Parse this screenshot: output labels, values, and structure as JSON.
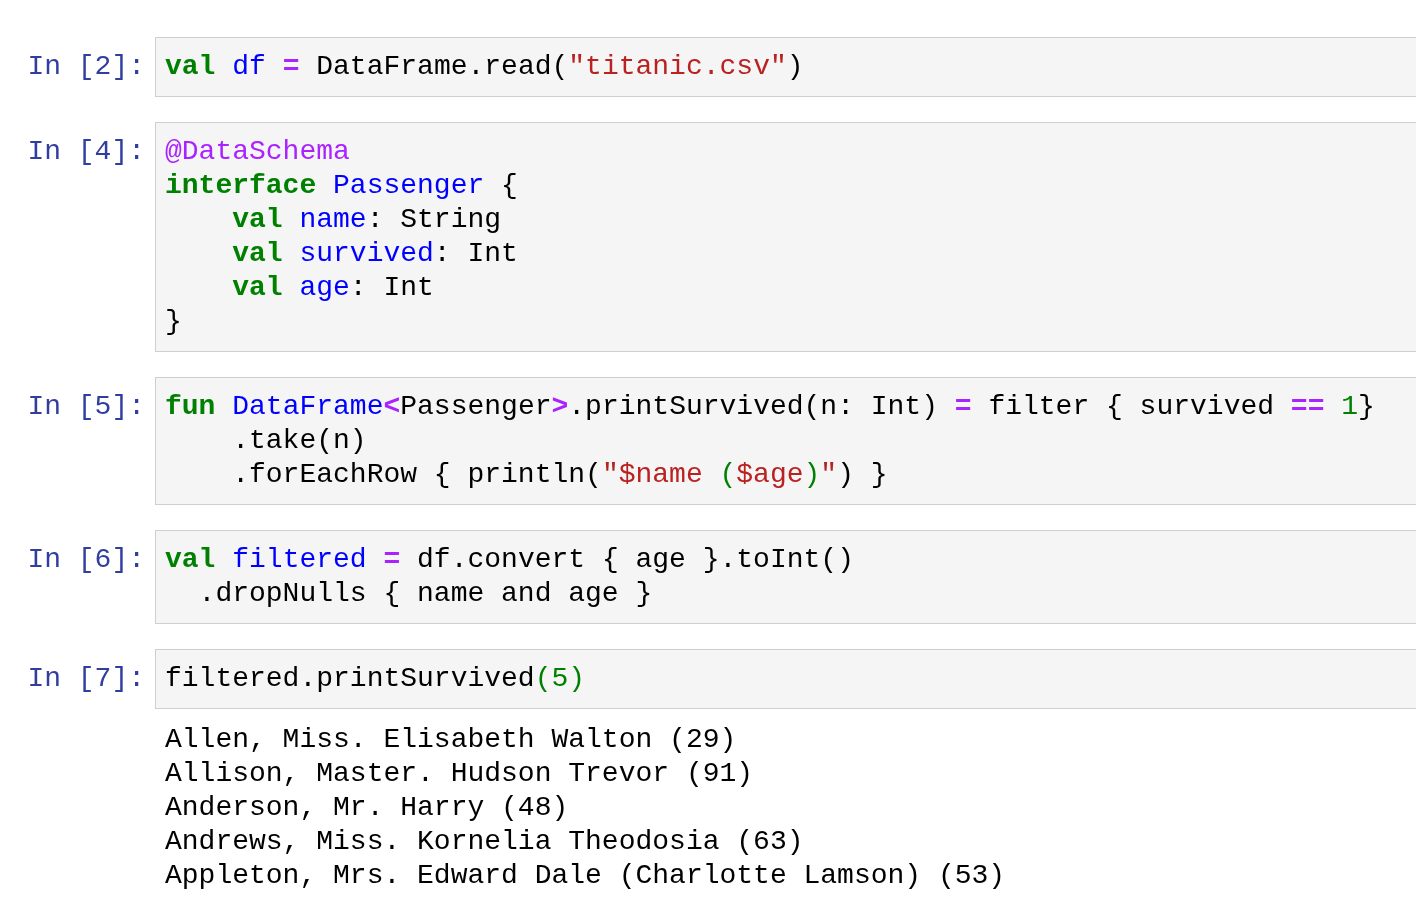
{
  "cells": [
    {
      "prompt": "In [2]:",
      "lines": [
        [
          {
            "kind": "keyword",
            "text": "val"
          },
          {
            "kind": "name",
            "text": " df"
          },
          {
            "kind": "operator",
            "text": " ="
          },
          {
            "kind": "plain",
            "text": " DataFrame.read("
          },
          {
            "kind": "string",
            "text": "\"titanic.csv\""
          },
          {
            "kind": "plain",
            "text": ")"
          }
        ]
      ]
    },
    {
      "prompt": "In [4]:",
      "lines": [
        [
          {
            "kind": "decorator",
            "text": "@DataSchema"
          }
        ],
        [
          {
            "kind": "keyword",
            "text": "interface"
          },
          {
            "kind": "name",
            "text": " Passenger"
          },
          {
            "kind": "plain",
            "text": " {"
          }
        ],
        [
          {
            "kind": "keyword",
            "text": "    val"
          },
          {
            "kind": "name",
            "text": " name"
          },
          {
            "kind": "plain",
            "text": ": String"
          }
        ],
        [
          {
            "kind": "keyword",
            "text": "    val"
          },
          {
            "kind": "name",
            "text": " survived"
          },
          {
            "kind": "plain",
            "text": ": Int"
          }
        ],
        [
          {
            "kind": "keyword",
            "text": "    val"
          },
          {
            "kind": "name",
            "text": " age"
          },
          {
            "kind": "plain",
            "text": ": Int"
          }
        ],
        [
          {
            "kind": "plain",
            "text": "}"
          }
        ]
      ]
    },
    {
      "prompt": "In [5]:",
      "lines": [
        [
          {
            "kind": "keyword",
            "text": "fun"
          },
          {
            "kind": "name",
            "text": " DataFrame"
          },
          {
            "kind": "operator",
            "text": "<"
          },
          {
            "kind": "plain",
            "text": "Passenger"
          },
          {
            "kind": "operator",
            "text": ">"
          },
          {
            "kind": "plain",
            "text": ".printSurvived(n: Int) "
          },
          {
            "kind": "operator",
            "text": "="
          },
          {
            "kind": "plain",
            "text": " filter { survived "
          },
          {
            "kind": "operator",
            "text": "=="
          },
          {
            "kind": "number",
            "text": " 1"
          },
          {
            "kind": "plain",
            "text": "}"
          }
        ],
        [
          {
            "kind": "plain",
            "text": "    .take(n)"
          }
        ],
        [
          {
            "kind": "plain",
            "text": "    .forEachRow { println("
          },
          {
            "kind": "string",
            "text": "\"$name "
          },
          {
            "kind": "number",
            "text": "("
          },
          {
            "kind": "string",
            "text": "$age"
          },
          {
            "kind": "number",
            "text": ")"
          },
          {
            "kind": "string",
            "text": "\""
          },
          {
            "kind": "plain",
            "text": ") }"
          }
        ]
      ]
    },
    {
      "prompt": "In [6]:",
      "lines": [
        [
          {
            "kind": "keyword",
            "text": "val"
          },
          {
            "kind": "name",
            "text": " filtered"
          },
          {
            "kind": "operator",
            "text": " ="
          },
          {
            "kind": "plain",
            "text": " df.convert { age }.toInt()"
          }
        ],
        [
          {
            "kind": "plain",
            "text": "  .dropNulls { name and age }"
          }
        ]
      ]
    },
    {
      "prompt": "In [7]:",
      "lines": [
        [
          {
            "kind": "plain",
            "text": "filtered.printSurvived"
          },
          {
            "kind": "number",
            "text": "(5)"
          }
        ]
      ],
      "output": [
        "Allen, Miss. Elisabeth Walton (29)",
        "Allison, Master. Hudson Trevor (91)",
        "Anderson, Mr. Harry (48)",
        "Andrews, Miss. Kornelia Theodosia (63)",
        "Appleton, Mrs. Edward Dale (Charlotte Lamson) (53)"
      ]
    }
  ]
}
